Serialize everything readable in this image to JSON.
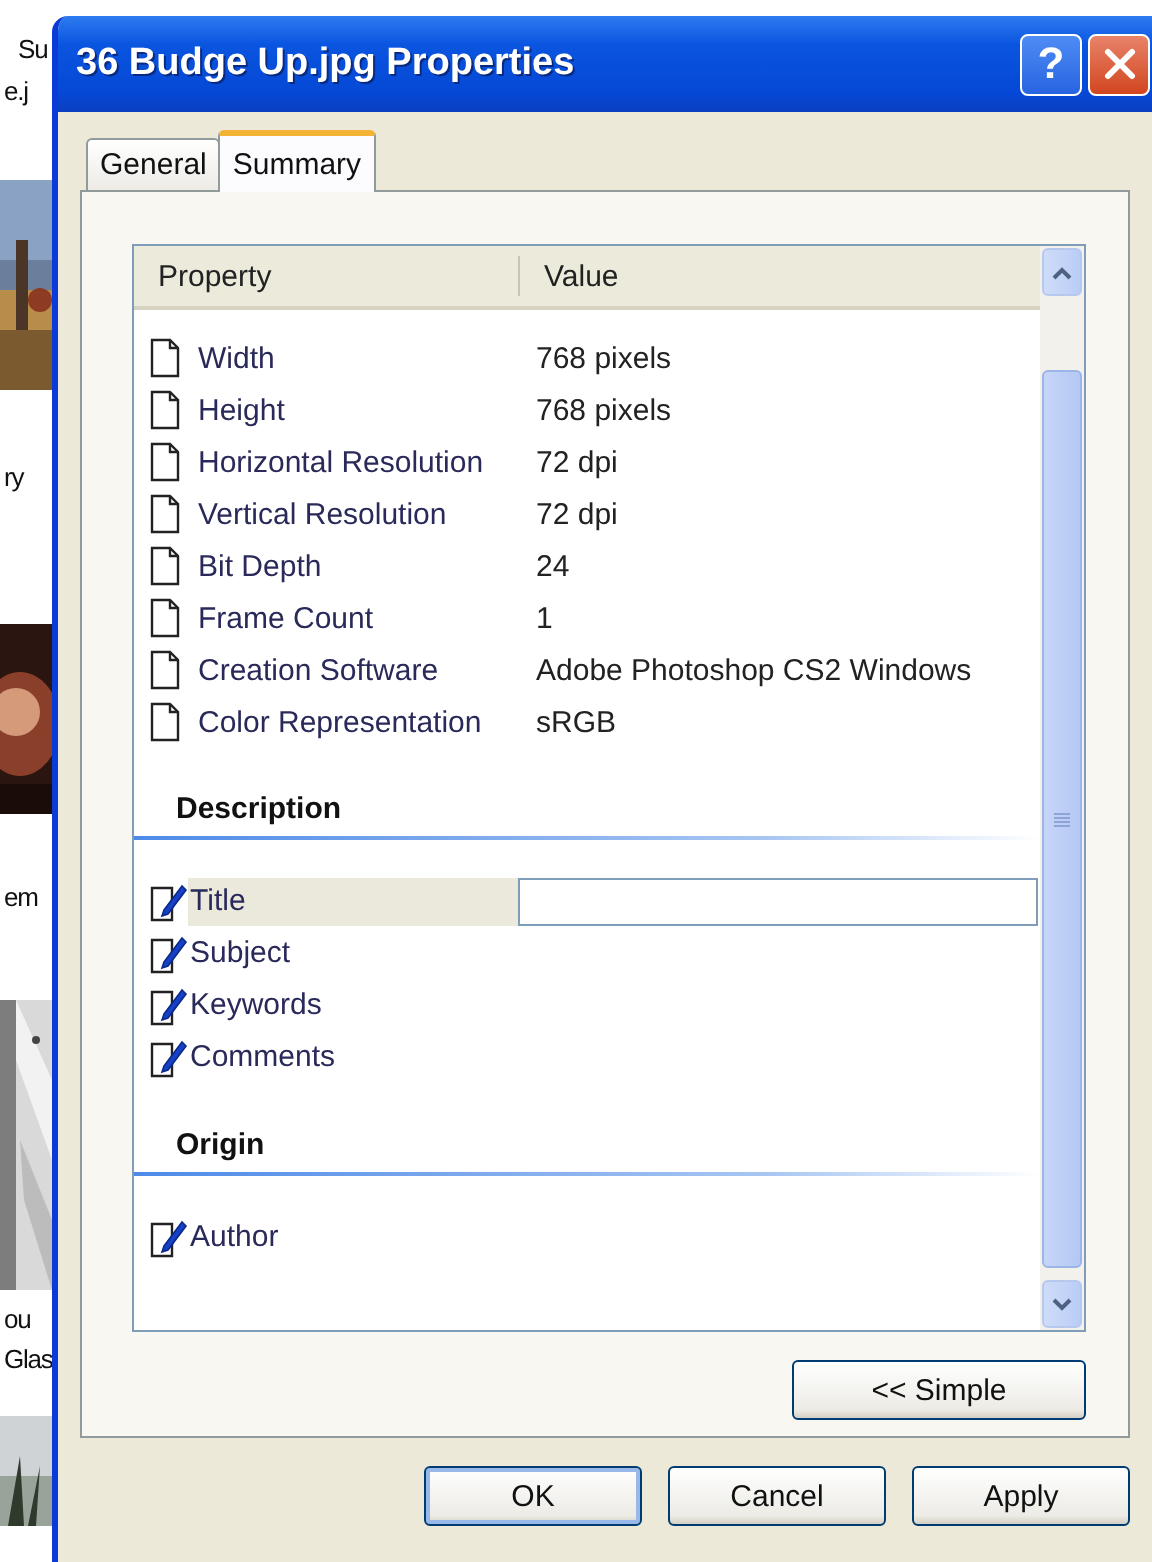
{
  "background_window": {
    "items": [
      {
        "kind": "text",
        "text": "Su"
      },
      {
        "kind": "text",
        "text": "e.j"
      },
      {
        "kind": "picture"
      },
      {
        "kind": "text",
        "text": "ry"
      },
      {
        "kind": "picture"
      },
      {
        "kind": "text",
        "text": "em"
      },
      {
        "kind": "picture"
      },
      {
        "kind": "text",
        "text": "ou"
      },
      {
        "kind": "text",
        "text": "Glas"
      },
      {
        "kind": "picture"
      }
    ]
  },
  "window": {
    "title": "36 Budge Up.jpg Properties",
    "help_button": "?"
  },
  "tabs": [
    {
      "label": "General",
      "selected": false
    },
    {
      "label": "Summary",
      "selected": true
    }
  ],
  "property_list": {
    "columns": [
      "Property",
      "Value"
    ],
    "rows": [
      {
        "kind": "readonly",
        "name": "Width",
        "value": "768 pixels"
      },
      {
        "kind": "readonly",
        "name": "Height",
        "value": "768 pixels"
      },
      {
        "kind": "readonly",
        "name": "Horizontal Resolution",
        "value": "72 dpi"
      },
      {
        "kind": "readonly",
        "name": "Vertical Resolution",
        "value": "72 dpi"
      },
      {
        "kind": "readonly",
        "name": "Bit Depth",
        "value": "24"
      },
      {
        "kind": "readonly",
        "name": "Frame Count",
        "value": "1"
      },
      {
        "kind": "readonly",
        "name": "Creation Software",
        "value": "Adobe Photoshop CS2 Windows"
      },
      {
        "kind": "readonly",
        "name": "Color Representation",
        "value": "sRGB"
      },
      {
        "kind": "heading",
        "label": "Description"
      },
      {
        "kind": "editable",
        "name": "Title",
        "selected": true
      },
      {
        "kind": "editable",
        "name": "Subject",
        "selected": false
      },
      {
        "kind": "editable",
        "name": "Keywords",
        "selected": false
      },
      {
        "kind": "editable",
        "name": "Comments",
        "selected": false
      },
      {
        "kind": "heading",
        "label": "Origin"
      },
      {
        "kind": "editable",
        "name": "Author",
        "selected": false
      }
    ]
  },
  "simple_button": "<< Simple",
  "buttons": [
    {
      "label": "OK",
      "default": true
    },
    {
      "label": "Cancel",
      "default": false
    },
    {
      "label": "Apply",
      "default": false
    }
  ]
}
